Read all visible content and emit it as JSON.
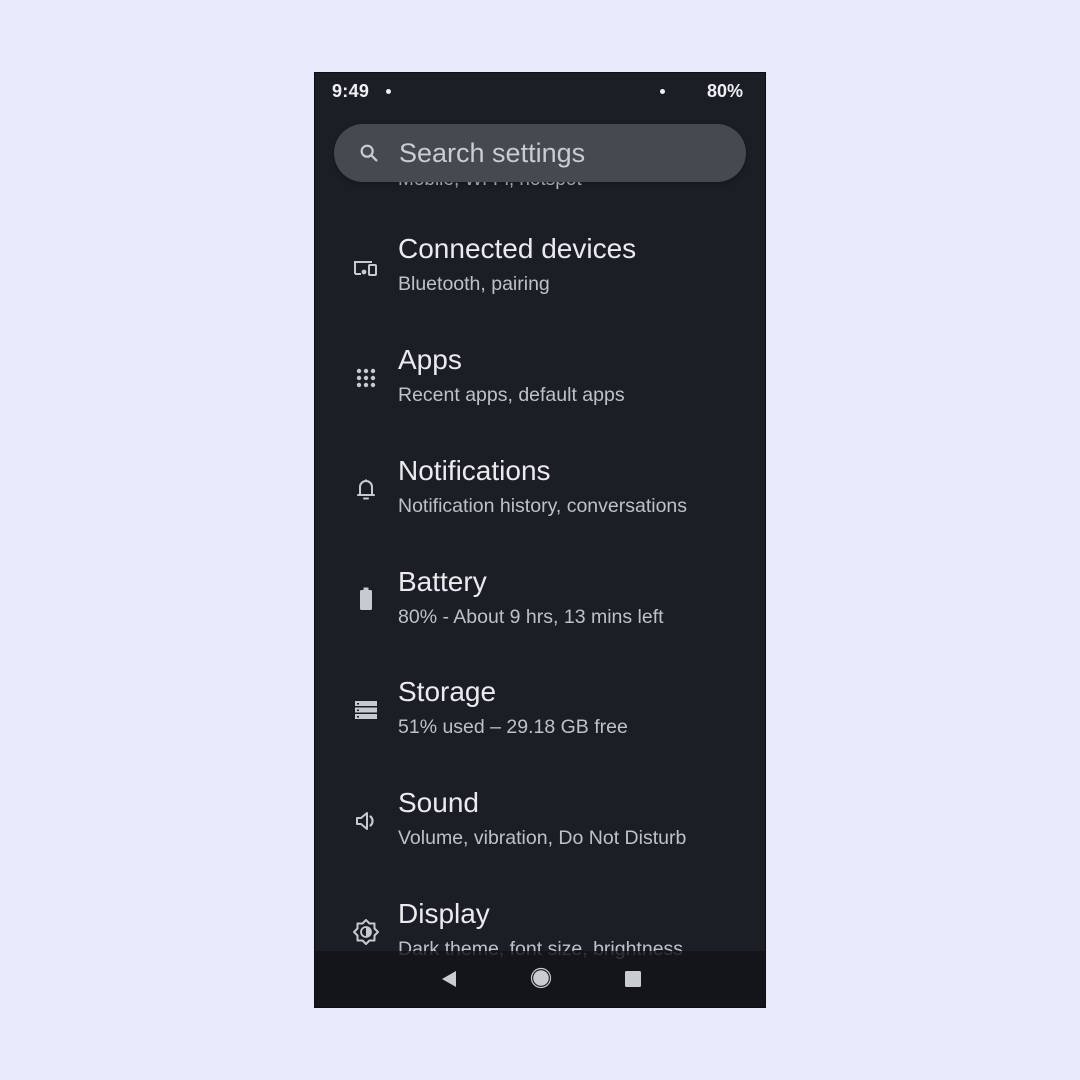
{
  "status_bar": {
    "time": "9:49",
    "battery": "80%"
  },
  "search": {
    "placeholder": "Search settings"
  },
  "partial_item": {
    "summary": "Mobile, Wi-Fi, hotspot"
  },
  "settings_items": [
    {
      "icon": "connected-devices-icon",
      "title": "Connected devices",
      "summary": "Bluetooth, pairing"
    },
    {
      "icon": "apps-grid-icon",
      "title": "Apps",
      "summary": "Recent apps, default apps"
    },
    {
      "icon": "bell-icon",
      "title": "Notifications",
      "summary": "Notification history, conversations"
    },
    {
      "icon": "battery-icon",
      "title": "Battery",
      "summary": "80% - About 9 hrs, 13 mins left"
    },
    {
      "icon": "storage-icon",
      "title": "Storage",
      "summary": "51% used – 29.18 GB free"
    },
    {
      "icon": "volume-icon",
      "title": "Sound",
      "summary": "Volume, vibration, Do Not Disturb"
    },
    {
      "icon": "display-brightness-icon",
      "title": "Display",
      "summary": "Dark theme, font size, brightness"
    }
  ],
  "nav_bar": {
    "back": "back-icon",
    "home": "home-icon",
    "recents": "recents-icon"
  },
  "colors": {
    "page_background": "#e8eafb",
    "screen_background": "#1b1f25",
    "search_bar": "#454a50",
    "primary_text": "#e9ebee",
    "secondary_text": "#bec2c8",
    "icon": "#c5cbd0"
  }
}
